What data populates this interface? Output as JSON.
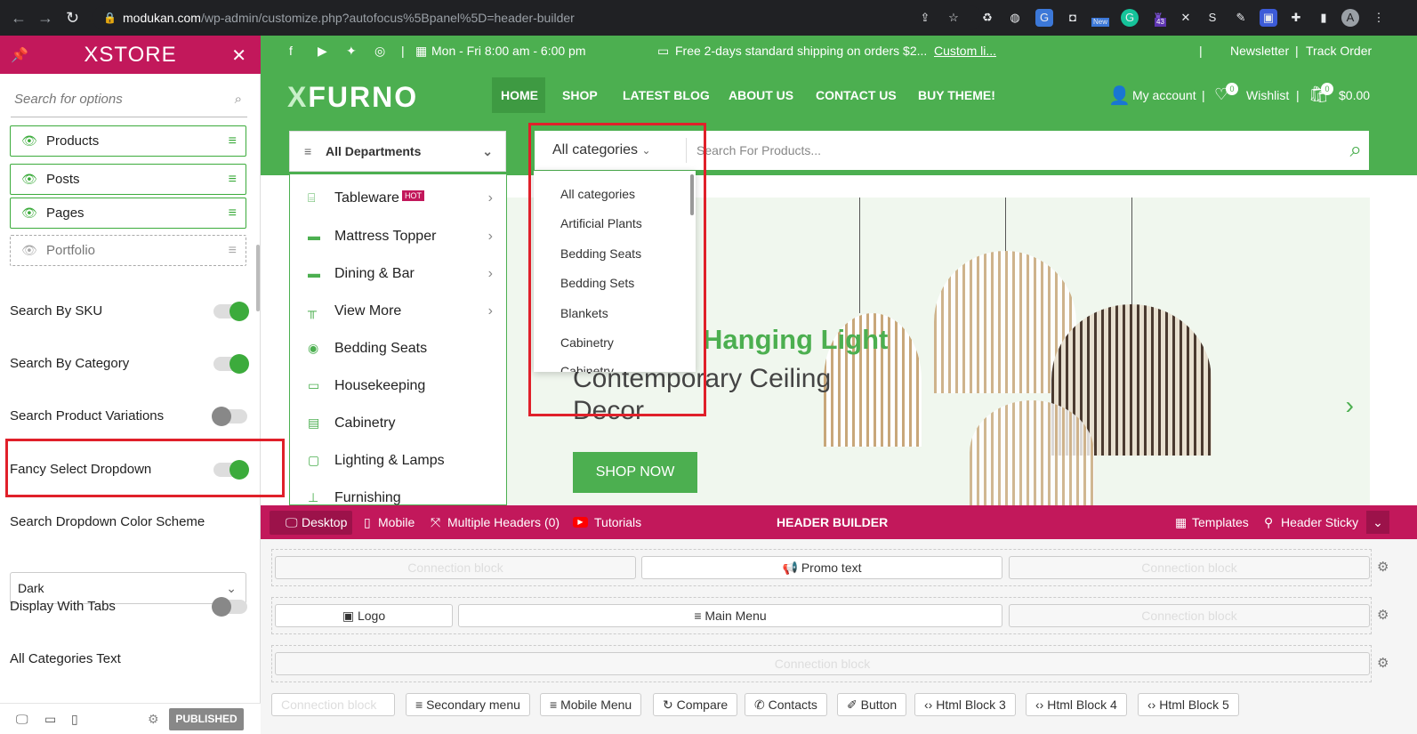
{
  "browser": {
    "url_host": "modukan.com",
    "url_path": "/wp-admin/customize.php?autofocus%5Bpanel%5D=header-builder",
    "profile_initial": "A",
    "badge_new": "New",
    "badge_count": "43"
  },
  "sidebar": {
    "brand": "XSTORE",
    "search_placeholder": "Search for options",
    "items": [
      {
        "label": "Products"
      },
      {
        "label": "Posts"
      },
      {
        "label": "Pages"
      },
      {
        "label": "Portfolio"
      }
    ],
    "settings": [
      {
        "label": "Search By SKU",
        "state": "on"
      },
      {
        "label": "Search By Category",
        "state": "on"
      },
      {
        "label": "Search Product Variations",
        "state": "off"
      },
      {
        "label": "Fancy Select Dropdown",
        "state": "on"
      }
    ],
    "color_scheme_label": "Search Dropdown Color Scheme",
    "color_scheme_value": "Dark",
    "tabs_label": "Display With Tabs",
    "tabs_state": "off",
    "all_cat_label": "All Categories Text",
    "publish": "PUBLISHED"
  },
  "topbar": {
    "hours": "Mon - Fri 8:00 am - 6:00 pm",
    "shipping": "Free 2-days standard shipping on orders $2...",
    "custom_link": "Custom li...",
    "newsletter": "Newsletter",
    "track": "Track Order"
  },
  "header": {
    "brand_a": "X",
    "brand_b": "FURNO",
    "menu": [
      "HOME",
      "SHOP",
      "LATEST BLOG",
      "ABOUT US",
      "CONTACT US",
      "BUY THEME!"
    ],
    "account": "My account",
    "wishlist": "Wishlist",
    "wishlist_count": "0",
    "cart": "$0.00",
    "cart_count": "0"
  },
  "search": {
    "departments": "All Departments",
    "category": "All categories",
    "placeholder": "Search For Products..."
  },
  "departments": [
    {
      "label": "Tableware",
      "hot": "HOT",
      "arrow": true
    },
    {
      "label": "Mattress Topper",
      "arrow": true
    },
    {
      "label": "Dining & Bar",
      "arrow": true
    },
    {
      "label": "View More",
      "arrow": true
    },
    {
      "label": "Bedding Seats"
    },
    {
      "label": "Housekeeping"
    },
    {
      "label": "Cabinetry"
    },
    {
      "label": "Lighting & Lamps"
    },
    {
      "label": "Furnishing"
    }
  ],
  "category_dropdown": [
    "All categories",
    "Artificial Plants",
    "Bedding Seats",
    "Bedding Sets",
    "Blankets",
    "Cabinetry",
    "Cabinetry"
  ],
  "hero": {
    "title": "Hanging Light",
    "subtitle": "Contemporary Ceiling Decor",
    "button": "SHOP NOW"
  },
  "builder": {
    "desktop": "Desktop",
    "mobile": "Mobile",
    "multi": "Multiple Headers (0)",
    "tutorials": "Tutorials",
    "title": "HEADER BUILDER",
    "templates": "Templates",
    "sticky": "Header Sticky",
    "row1": [
      "Connection block",
      "Promo text",
      "Connection block"
    ],
    "row2": [
      "Logo",
      "Main Menu",
      "Connection block"
    ],
    "row3": [
      "Connection block"
    ],
    "chips": [
      "Connection block",
      "Secondary menu",
      "Mobile Menu",
      "Compare",
      "Contacts",
      "Button",
      "Html Block 3",
      "Html Block 4",
      "Html Block 5"
    ]
  }
}
